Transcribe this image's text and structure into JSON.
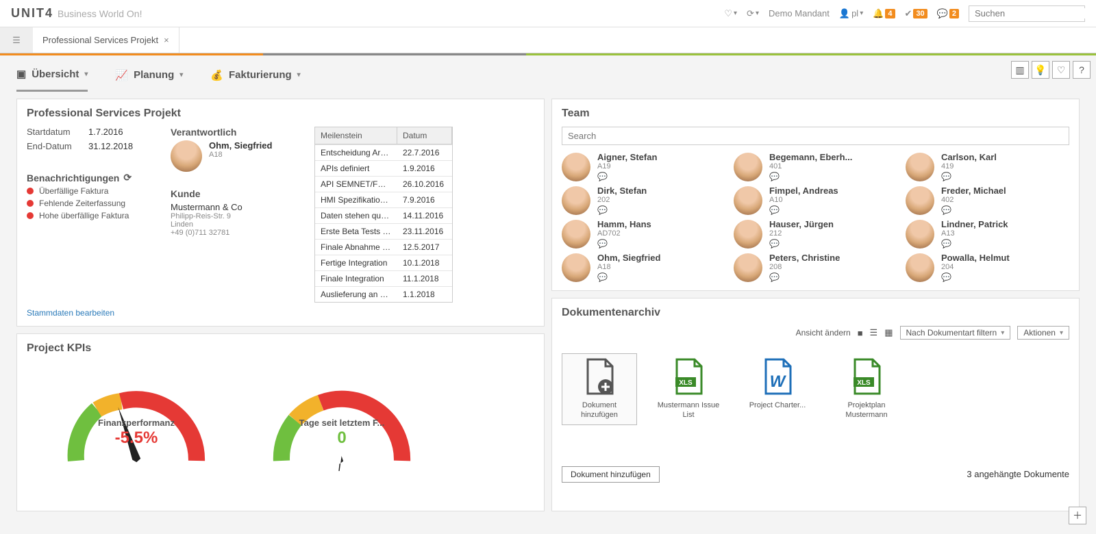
{
  "header": {
    "brand": "UNIT4",
    "brand_sub": "Business World On!",
    "tenant": "Demo Mandant",
    "user": "pl",
    "notif_count": "4",
    "tasks_count": "30",
    "messages_count": "2",
    "search_placeholder": "Suchen"
  },
  "tabs": {
    "active_label": "Professional Services Projekt"
  },
  "nav": {
    "overview": "Übersicht",
    "planning": "Planung",
    "billing": "Fakturierung"
  },
  "project_panel": {
    "title": "Professional Services Projekt",
    "start_label": "Startdatum",
    "start_value": "1.7.2016",
    "end_label": "End-Datum",
    "end_value": "31.12.2018",
    "responsible_label": "Verantwortlich",
    "responsible_name": "Ohm, Siegfried",
    "responsible_id": "A18",
    "customer_label": "Kunde",
    "customer_name": "Mustermann & Co",
    "customer_addr1": "Philipp-Reis-Str. 9",
    "customer_addr2": "Linden",
    "customer_phone": "+49 (0)711 32781",
    "notif_label": "Benachrichtigungen",
    "notifications": [
      "Überfällige Faktura",
      "Fehlende Zeiterfassung",
      "Hohe überfällige Faktura"
    ],
    "milestone_hdr1": "Meilenstein",
    "milestone_hdr2": "Datum",
    "milestones": [
      {
        "name": "Entscheidung Archite...",
        "date": "22.7.2016"
      },
      {
        "name": "APIs definiert",
        "date": "1.9.2016"
      },
      {
        "name": "API SEMNET/FW ver...",
        "date": "26.10.2016"
      },
      {
        "name": "HMI Spezifikation de...",
        "date": "7.9.2016"
      },
      {
        "name": "Daten stehen quersc...",
        "date": "14.11.2016"
      },
      {
        "name": "Erste Beta Tests erfol...",
        "date": "23.11.2016"
      },
      {
        "name": "Finale Abnahme der ...",
        "date": "12.5.2017"
      },
      {
        "name": "Fertige Integration",
        "date": "10.1.2018"
      },
      {
        "name": "Finale Integration",
        "date": "11.1.2018"
      },
      {
        "name": "Auslieferung an Kund...",
        "date": "1.1.2018"
      }
    ],
    "edit_link": "Stammdaten bearbeiten"
  },
  "kpi_panel": {
    "title": "Project KPIs",
    "gauge1_label": "Finanzperformanz",
    "gauge1_value": "-5.5%",
    "gauge2_label": "Tage seit letztem F...",
    "gauge2_value": "0"
  },
  "team_panel": {
    "title": "Team",
    "search_placeholder": "Search",
    "members": [
      {
        "name": "Aigner, Stefan",
        "id": "A19"
      },
      {
        "name": "Begemann, Eberh...",
        "id": "401"
      },
      {
        "name": "Carlson, Karl",
        "id": "419"
      },
      {
        "name": "Dirk, Stefan",
        "id": "202"
      },
      {
        "name": "Fimpel, Andreas",
        "id": "A10"
      },
      {
        "name": "Freder, Michael",
        "id": "402"
      },
      {
        "name": "Hamm, Hans",
        "id": "AD702"
      },
      {
        "name": "Hauser, Jürgen",
        "id": "212"
      },
      {
        "name": "Lindner, Patrick",
        "id": "A13"
      },
      {
        "name": "Ohm, Siegfried",
        "id": "A18"
      },
      {
        "name": "Peters, Christine",
        "id": "208"
      },
      {
        "name": "Powalla, Helmut",
        "id": "204"
      }
    ]
  },
  "docs_panel": {
    "title": "Dokumentenarchiv",
    "view_label": "Ansicht ändern",
    "filter_label": "Nach Dokumentart filtern",
    "actions_label": "Aktionen",
    "add_doc_tile": "Dokument hinzufügen",
    "docs": [
      {
        "label": "Mustermann Issue List",
        "type": "xls"
      },
      {
        "label": "Project Charter...",
        "type": "word"
      },
      {
        "label": "Projektplan Mustermann",
        "type": "xls"
      }
    ],
    "add_button": "Dokument hinzufügen",
    "footer_count": "3 angehängte Dokumente"
  },
  "chart_data": [
    {
      "type": "gauge",
      "title": "Finanzperformanz",
      "value": -5.5,
      "unit": "%",
      "range": [
        -100,
        100
      ],
      "zones": [
        {
          "color": "#6fbf3f",
          "from": -100,
          "to": -40
        },
        {
          "color": "#f2b22b",
          "from": -40,
          "to": -20
        },
        {
          "color": "#e53935",
          "from": -20,
          "to": 100
        }
      ]
    },
    {
      "type": "gauge",
      "title": "Tage seit letztem F...",
      "value": 0,
      "range": [
        0,
        100
      ],
      "zones": [
        {
          "color": "#6fbf3f",
          "from": 0,
          "to": 20
        },
        {
          "color": "#f2b22b",
          "from": 20,
          "to": 40
        },
        {
          "color": "#e53935",
          "from": 40,
          "to": 100
        }
      ]
    }
  ]
}
